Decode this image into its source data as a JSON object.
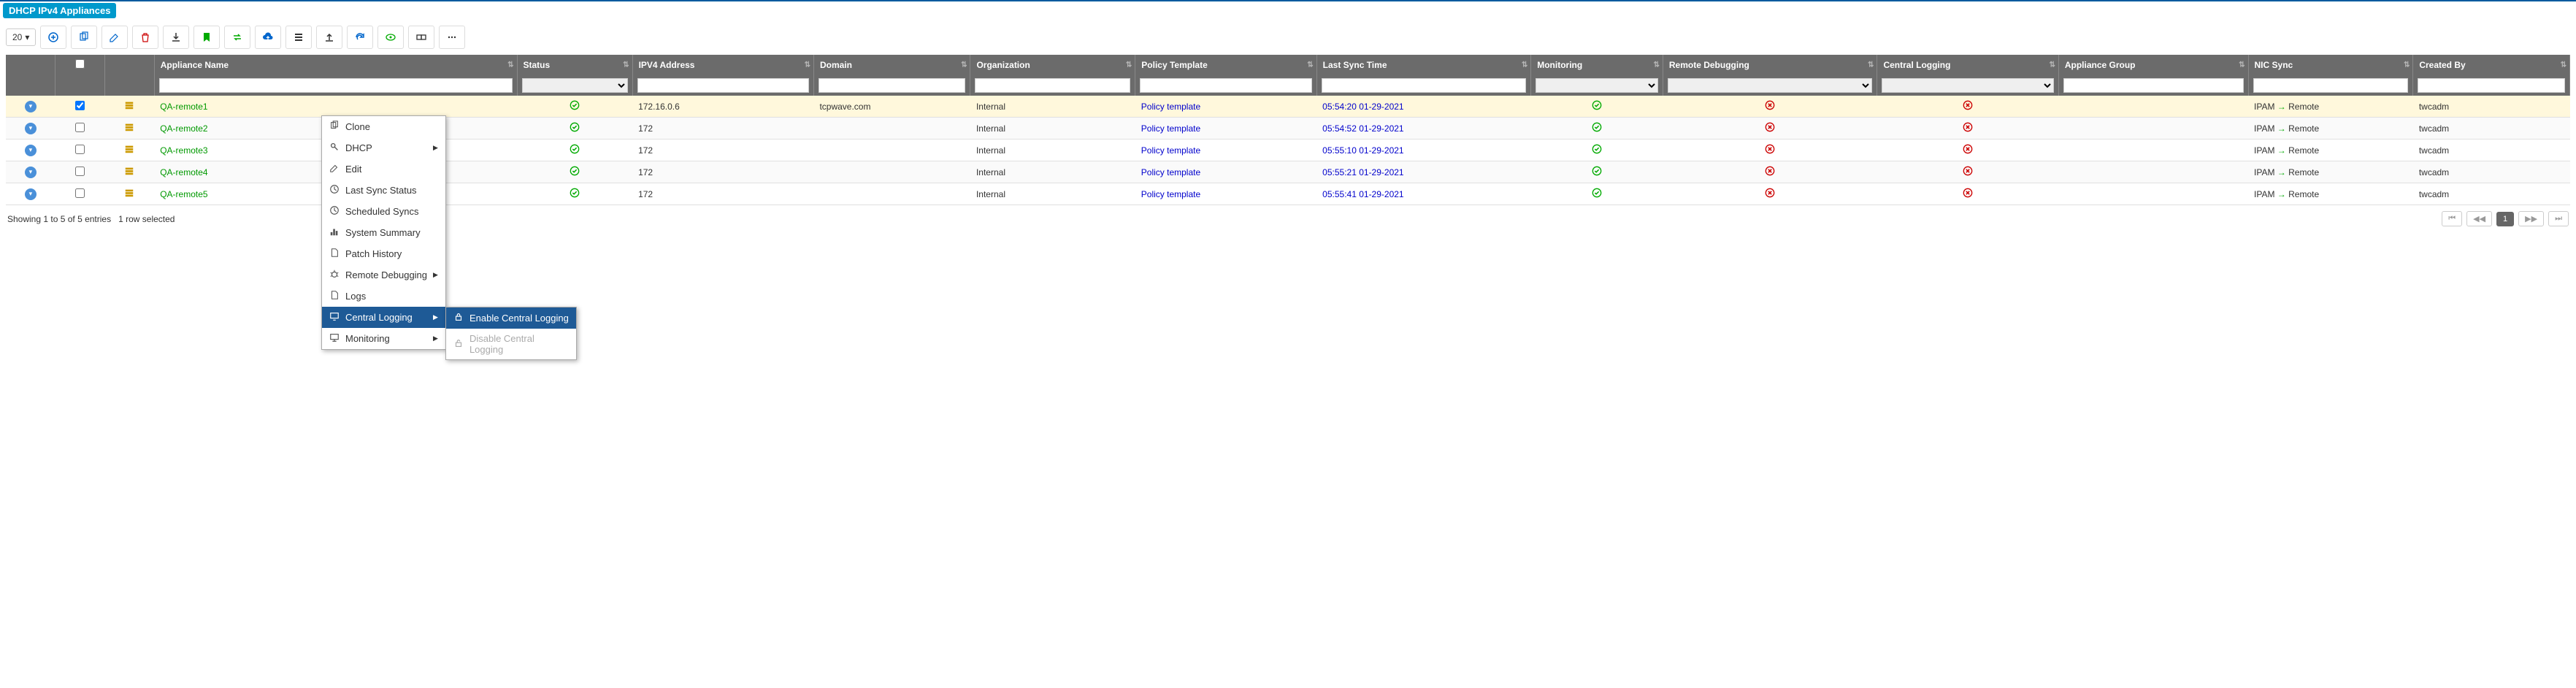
{
  "panel_title": "DHCP IPv4 Appliances",
  "page_size": "20",
  "columns": {
    "appliance_name": "Appliance Name",
    "status": "Status",
    "ipv4_address": "IPV4 Address",
    "domain": "Domain",
    "organization": "Organization",
    "policy_template": "Policy Template",
    "last_sync_time": "Last Sync Time",
    "monitoring": "Monitoring",
    "remote_debugging": "Remote Debugging",
    "central_logging": "Central Logging",
    "appliance_group": "Appliance Group",
    "nic_sync": "NIC Sync",
    "created_by": "Created By"
  },
  "rows": [
    {
      "name": "QA-remote1",
      "ip": "172.16.0.6",
      "domain": "tcpwave.com",
      "org": "Internal",
      "policy": "Policy template",
      "sync": "05:54:20 01-29-2021",
      "created": "twcadm",
      "nic_from": "IPAM",
      "nic_to": "Remote",
      "selected": true
    },
    {
      "name": "QA-remote2",
      "ip": "172",
      "domain": "",
      "org": "Internal",
      "policy": "Policy template",
      "sync": "05:54:52 01-29-2021",
      "created": "twcadm",
      "nic_from": "IPAM",
      "nic_to": "Remote",
      "selected": false
    },
    {
      "name": "QA-remote3",
      "ip": "172",
      "domain": "",
      "org": "Internal",
      "policy": "Policy template",
      "sync": "05:55:10 01-29-2021",
      "created": "twcadm",
      "nic_from": "IPAM",
      "nic_to": "Remote",
      "selected": false
    },
    {
      "name": "QA-remote4",
      "ip": "172",
      "domain": "",
      "org": "Internal",
      "policy": "Policy template",
      "sync": "05:55:21 01-29-2021",
      "created": "twcadm",
      "nic_from": "IPAM",
      "nic_to": "Remote",
      "selected": false
    },
    {
      "name": "QA-remote5",
      "ip": "172",
      "domain": "",
      "org": "Internal",
      "policy": "Policy template",
      "sync": "05:55:41 01-29-2021",
      "created": "twcadm",
      "nic_from": "IPAM",
      "nic_to": "Remote",
      "selected": false
    }
  ],
  "footer": {
    "info": "Showing 1 to 5 of 5 entries",
    "selection": "1 row selected",
    "page": "1"
  },
  "context_menu": {
    "items": [
      {
        "label": "Clone",
        "icon": "copy"
      },
      {
        "label": "DHCP",
        "icon": "wrench",
        "submenu": true
      },
      {
        "label": "Edit",
        "icon": "pencil"
      },
      {
        "label": "Last Sync Status",
        "icon": "clock"
      },
      {
        "label": "Scheduled Syncs",
        "icon": "clock"
      },
      {
        "label": "System Summary",
        "icon": "barchart"
      },
      {
        "label": "Patch History",
        "icon": "doc"
      },
      {
        "label": "Remote Debugging",
        "icon": "bug",
        "submenu": true
      },
      {
        "label": "Logs",
        "icon": "doc"
      },
      {
        "label": "Central Logging",
        "icon": "screen",
        "submenu": true,
        "highlighted": true
      },
      {
        "label": "Monitoring",
        "icon": "monitor",
        "submenu": true
      }
    ],
    "submenu": {
      "enable": "Enable Central Logging",
      "disable": "Disable Central Logging"
    }
  }
}
